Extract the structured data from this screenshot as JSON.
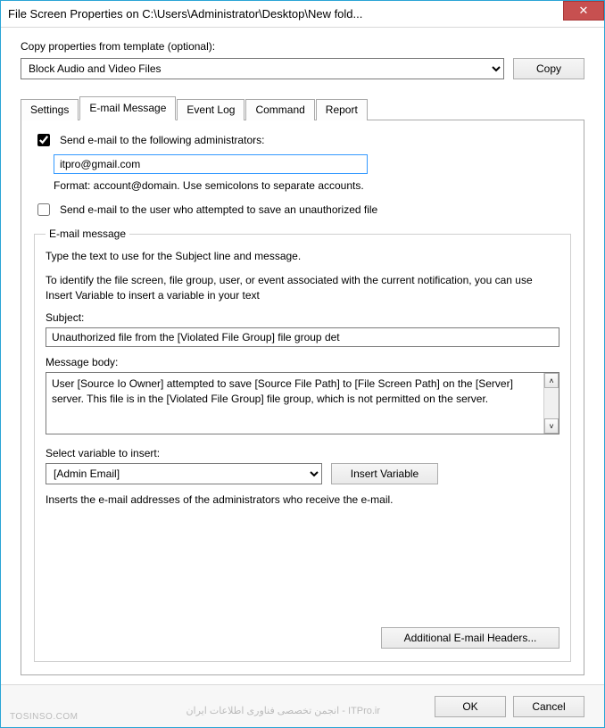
{
  "window": {
    "title": "File Screen Properties on C:\\Users\\Administrator\\Desktop\\New fold..."
  },
  "template": {
    "label": "Copy properties from template (optional):",
    "selected": "Block Audio and Video Files",
    "copy_button": "Copy"
  },
  "tabs": [
    {
      "label": "Settings"
    },
    {
      "label": "E-mail Message"
    },
    {
      "label": "Event Log"
    },
    {
      "label": "Command"
    },
    {
      "label": "Report"
    }
  ],
  "email": {
    "send_admins_label": "Send e-mail to the following administrators:",
    "send_admins_checked": true,
    "admins_value": "itpro@gmail.com",
    "format_hint": "Format: account@domain. Use semicolons to separate accounts.",
    "send_user_label": "Send e-mail to the user who attempted to save an unauthorized file",
    "send_user_checked": false,
    "group_legend": "E-mail message",
    "instructions_line1": "Type the text to use for the Subject line and message.",
    "instructions_line2": "To identify the file screen, file group, user, or event associated with the current notification, you can use Insert Variable to insert a variable in your text",
    "subject_label": "Subject:",
    "subject_value": "Unauthorized file from the [Violated File Group] file group det",
    "body_label": "Message body:",
    "body_value": "User [Source Io Owner] attempted to save [Source File Path] to [File Screen Path] on the [Server] server. This file is in the [Violated File Group] file group, which is not permitted on the server.",
    "var_select_label": "Select variable to insert:",
    "var_selected": "[Admin Email]",
    "insert_var_button": "Insert Variable",
    "var_description": "Inserts the e-mail addresses of the administrators who receive the e-mail.",
    "additional_headers_button": "Additional E-mail Headers..."
  },
  "footer": {
    "ok": "OK",
    "cancel": "Cancel",
    "watermark_left": "TOSINSO.COM",
    "watermark_center": "ITPro.ir - انجمن تخصصی فناوری اطلاعات ایران"
  }
}
